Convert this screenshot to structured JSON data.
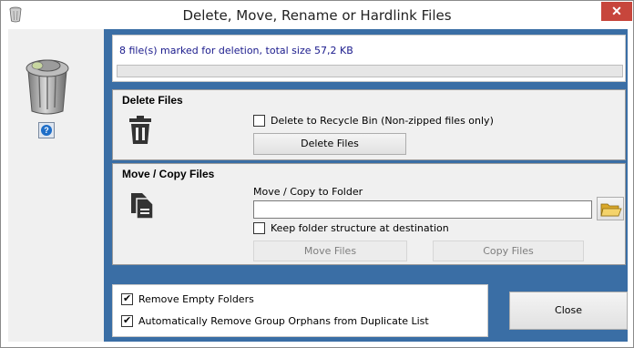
{
  "window": {
    "title": "Delete, Move, Rename or Hardlink Files",
    "close_glyph": "✕"
  },
  "status": {
    "message": "8 file(s) marked for deletion, total size 57,2 KB",
    "progress": 0
  },
  "help": {
    "glyph": "?"
  },
  "delete_group": {
    "title": "Delete Files",
    "recycle_checkbox": {
      "label": "Delete to Recycle Bin (Non-zipped files only)",
      "checked": false
    },
    "delete_button": "Delete Files"
  },
  "move_group": {
    "title": "Move / Copy Files",
    "folder_label": "Move / Copy to Folder",
    "folder_value": "",
    "keep_structure_checkbox": {
      "label": "Keep folder structure at destination",
      "checked": false
    },
    "move_button": "Move Files",
    "copy_button": "Copy Files"
  },
  "options": {
    "remove_empty": {
      "label": "Remove Empty Folders",
      "checked": true
    },
    "remove_orphans": {
      "label": "Automatically Remove Group Orphans from Duplicate List",
      "checked": true
    }
  },
  "close_button": "Close",
  "colors": {
    "accent": "#3a6ea5",
    "status_text": "#1a1a8c",
    "close_red": "#c7463c"
  },
  "icons": [
    "trash-can-icon",
    "help-icon",
    "delete-bin-icon",
    "copy-files-icon",
    "folder-open-icon",
    "app-icon"
  ]
}
